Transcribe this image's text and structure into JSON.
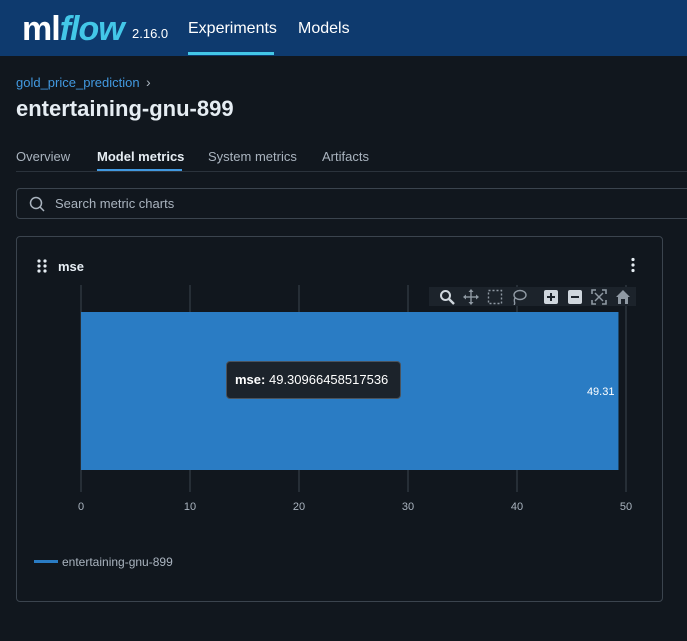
{
  "header": {
    "logo_ml": "ml",
    "logo_flow": "flow",
    "version": "2.16.0",
    "nav": [
      "Experiments",
      "Models"
    ],
    "active_nav": "Experiments"
  },
  "breadcrumb": {
    "parent": "gold_price_prediction",
    "separator": "›"
  },
  "run_title": "entertaining-gnu-899",
  "tabs": [
    {
      "label": "Overview",
      "active": false
    },
    {
      "label": "Model metrics",
      "active": true
    },
    {
      "label": "System metrics",
      "active": false
    },
    {
      "label": "Artifacts",
      "active": false
    }
  ],
  "search": {
    "placeholder": "Search metric charts",
    "value": ""
  },
  "card": {
    "title": "mse",
    "tooltip": {
      "label": "mse:",
      "value": "49.30966458517536"
    },
    "legend": [
      "entertaining-gnu-899"
    ],
    "modebar_icons": [
      "zoom-icon",
      "pan-icon",
      "box-select-icon",
      "lasso-icon",
      "zoom-in-icon",
      "zoom-out-icon",
      "autoscale-icon",
      "reset-axes-icon"
    ]
  },
  "colors": {
    "header_bg": "#0e3a6e",
    "accent": "#43c7e8",
    "link": "#4299e0",
    "bar": "#2a7cc4",
    "page_bg": "#11171e"
  },
  "chart_data": {
    "type": "bar",
    "orientation": "horizontal",
    "categories": [
      "entertaining-gnu-899"
    ],
    "values": [
      49.30966458517536
    ],
    "data_labels": [
      "49.31"
    ],
    "xlim": [
      0,
      50
    ],
    "xticks": [
      0,
      10,
      20,
      30,
      40,
      50
    ],
    "grid": true,
    "legend_position": "bottom-left"
  }
}
